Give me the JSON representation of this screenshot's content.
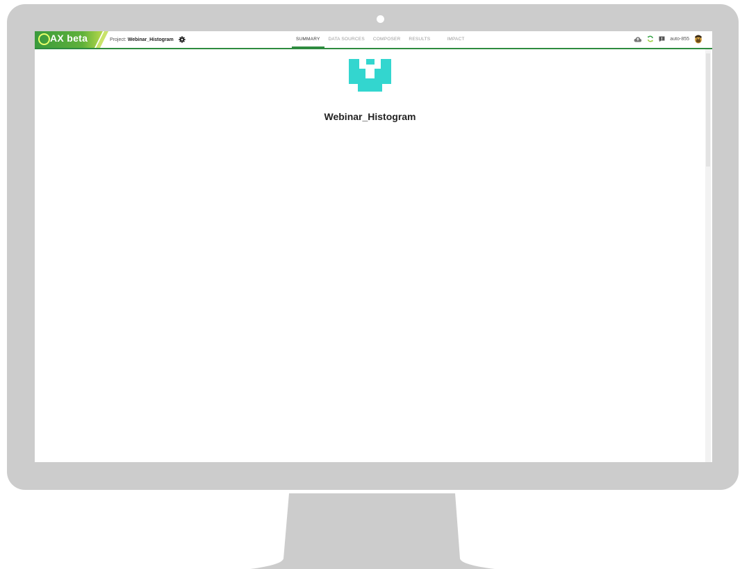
{
  "app": {
    "logo_text": "AX beta",
    "project_label": "Project:",
    "project_name": "Webinar_Histogram"
  },
  "tabs": [
    {
      "label": "SUMMARY",
      "active": true
    },
    {
      "label": "DATA SOURCES",
      "active": false
    },
    {
      "label": "COMPOSER",
      "active": false
    },
    {
      "label": "RESULTS",
      "active": false
    },
    {
      "label": "IMPACT",
      "active": false
    }
  ],
  "header_right": {
    "icons": [
      "cloud-icon",
      "refresh-icon",
      "feedback-icon",
      "user-avatar"
    ],
    "username": "auto-855"
  },
  "main": {
    "title": "Webinar_Histogram"
  },
  "colors": {
    "accent_green": "#2e8b3f",
    "logo_teal": "#33d6cf"
  }
}
